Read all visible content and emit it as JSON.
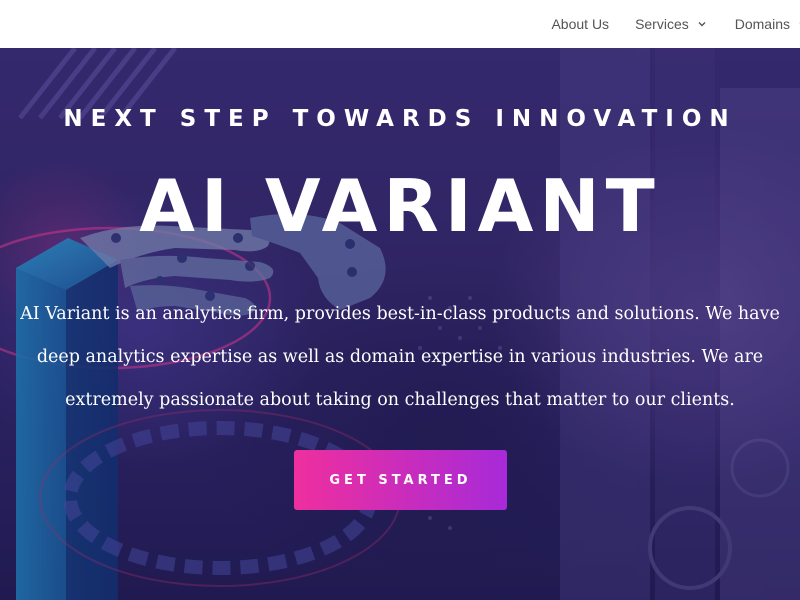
{
  "nav": {
    "items": [
      {
        "label": "About Us",
        "has_dropdown": false
      },
      {
        "label": "Services",
        "has_dropdown": true
      },
      {
        "label": "Domains",
        "has_dropdown": true
      }
    ]
  },
  "hero": {
    "eyebrow": "NEXT STEP TOWARDS INNOVATION",
    "title": "AI VARIANT",
    "description": "AI Variant is an analytics firm, provides best-in-class products and solutions. We have deep analytics expertise as well as domain expertise in various industries. We are extremely passionate about taking on challenges that matter to our clients.",
    "cta_label": "GET STARTED"
  },
  "colors": {
    "nav_background": "#ffffff",
    "nav_text": "#555555",
    "hero_background": "#332868",
    "cta_gradient_start": "#ef2f9e",
    "cta_gradient_end": "#a72ad8",
    "hero_text": "#ffffff"
  },
  "icons": {
    "dropdown": "chevron-down-icon"
  }
}
